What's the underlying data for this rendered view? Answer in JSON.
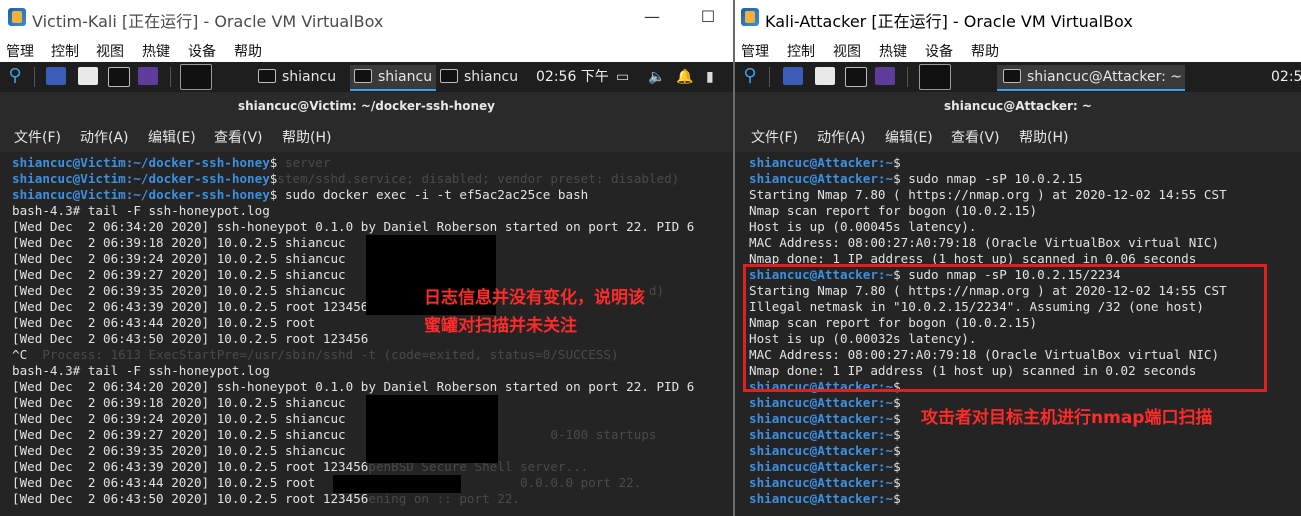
{
  "left_window": {
    "title": "Victim-Kali [正在运行] - Oracle VM VirtualBox",
    "minimize": "—",
    "restore": "☐",
    "menu": [
      "管理",
      "控制",
      "视图",
      "热键",
      "设备",
      "帮助"
    ],
    "taskbar": {
      "tasks": [
        "shiancu",
        "shiancu",
        "shiancu"
      ],
      "clock": "02:56 下午"
    },
    "terminal": {
      "title": "shiancuc@Victim: ~/docker-ssh-honey",
      "menu": [
        "文件(F)",
        "动作(A)",
        "编辑(E)",
        "查看(V)",
        "帮助(H)"
      ],
      "lines": [
        {
          "prompt_user": "shiancuc@Victim",
          "prompt_path": ":~/docker-ssh-honey",
          "prompt_char": "$",
          "text": "",
          "ghost": " server"
        },
        {
          "prompt_user": "shiancuc@Victim",
          "prompt_path": ":~/docker-ssh-honey",
          "prompt_char": "$",
          "text": "",
          "ghost": "stem/sshd.service; disabled; vendor preset: disabled)"
        },
        {
          "prompt_user": "shiancuc@Victim",
          "prompt_path": ":~/docker-ssh-honey",
          "prompt_char": "$",
          "text": " sudo docker exec -i -t ef5ac2ac25ce bash"
        },
        {
          "text": "bash-4.3# tail -F ssh-honeypot.log"
        },
        {
          "text": "[Wed Dec  2 06:34:20 2020] ssh-honeypot 0.1.0 by Daniel Roberson started on port 22. PID 6"
        },
        {
          "text": "[Wed Dec  2 06:39:18 2020] 10.0.2.5 shiancuc"
        },
        {
          "text": "[Wed Dec  2 06:39:24 2020] 10.0.2.5 shiancuc"
        },
        {
          "text": "[Wed Dec  2 06:39:27 2020] 10.0.2.5 shiancuc"
        },
        {
          "text": "[Wed Dec  2 06:39:35 2020] 10.0.2.5 shiancuc",
          "ghost": "                                        d)"
        },
        {
          "text": "[Wed Dec  2 06:43:39 2020] 10.0.2.5 root 123456"
        },
        {
          "text": "[Wed Dec  2 06:43:44 2020] 10.0.2.5 root"
        },
        {
          "text": "[Wed Dec  2 06:43:50 2020] 10.0.2.5 root 123456"
        },
        {
          "text": "^C",
          "ghost": "  Process: 1613 ExecStartPre=/usr/sbin/sshd -t (code=exited, status=0/SUCCESS)"
        },
        {
          "text": "bash-4.3# tail -F ssh-honeypot.log"
        },
        {
          "text": "[Wed Dec  2 06:34:20 2020] ssh-honeypot 0.1.0 by Daniel Roberson started on port 22. PID 6"
        },
        {
          "text": "[Wed Dec  2 06:39:18 2020] 10.0.2.5 shiancuc"
        },
        {
          "text": "[Wed Dec  2 06:39:24 2020] 10.0.2.5 shiancuc"
        },
        {
          "text": "[Wed Dec  2 06:39:27 2020] 10.0.2.5 shiancuc",
          "ghost": "                           0-100 startups"
        },
        {
          "text": "[Wed Dec  2 06:39:35 2020] 10.0.2.5 shiancuc"
        },
        {
          "text": "[Wed Dec  2 06:43:39 2020] 10.0.2.5 root 123456",
          "ghost": "penBSD Secure Shell server..."
        },
        {
          "text": "[Wed Dec  2 06:43:44 2020] 10.0.2.5 root",
          "ghost": "                           0.0.0.0 port 22."
        },
        {
          "text": "[Wed Dec  2 06:43:50 2020] 10.0.2.5 root 123456",
          "ghost": "ening on :: port 22."
        }
      ]
    },
    "annotation": "日志信息并没有变化，说明该\n蜜罐对扫描并未关注"
  },
  "right_window": {
    "title": "Kali-Attacker [正在运行] - Oracle VM VirtualBox",
    "menu": [
      "管理",
      "控制",
      "视图",
      "热键",
      "设备",
      "帮助"
    ],
    "taskbar": {
      "tasks": [
        "shiancuc@Attacker: ~"
      ],
      "clock": "02:5"
    },
    "terminal": {
      "title": "shiancuc@Attacker: ~",
      "menu": [
        "文件(F)",
        "动作(A)",
        "编辑(E)",
        "查看(V)",
        "帮助(H)"
      ],
      "lines": [
        {
          "prompt_user": "shiancuc@Attacker",
          "prompt_path": ":~",
          "prompt_char": "$",
          "text": ""
        },
        {
          "prompt_user": "shiancuc@Attacker",
          "prompt_path": ":~",
          "prompt_char": "$",
          "text": " sudo nmap -sP 10.0.2.15"
        },
        {
          "text": "Starting Nmap 7.80 ( https://nmap.org ) at 2020-12-02 14:55 CST"
        },
        {
          "text": "Nmap scan report for bogon (10.0.2.15)"
        },
        {
          "text": "Host is up (0.00045s latency)."
        },
        {
          "text": "MAC Address: 08:00:27:A0:79:18 (Oracle VirtualBox virtual NIC)"
        },
        {
          "text": "Nmap done: 1 IP address (1 host up) scanned in 0.06 seconds"
        },
        {
          "prompt_user": "shiancuc@Attacker",
          "prompt_path": ":~",
          "prompt_char": "$",
          "text": " sudo nmap -sP 10.0.2.15/2234"
        },
        {
          "text": "Starting Nmap 7.80 ( https://nmap.org ) at 2020-12-02 14:55 CST"
        },
        {
          "text": "Illegal netmask in \"10.0.2.15/2234\". Assuming /32 (one host)"
        },
        {
          "text": "Nmap scan report for bogon (10.0.2.15)"
        },
        {
          "text": "Host is up (0.00032s latency)."
        },
        {
          "text": "MAC Address: 08:00:27:A0:79:18 (Oracle VirtualBox virtual NIC)"
        },
        {
          "text": "Nmap done: 1 IP address (1 host up) scanned in 0.02 seconds"
        },
        {
          "prompt_user": "shiancuc@Attacker",
          "prompt_path": ":~",
          "prompt_char": "$",
          "text": ""
        },
        {
          "prompt_user": "shiancuc@Attacker",
          "prompt_path": ":~",
          "prompt_char": "$",
          "text": ""
        },
        {
          "prompt_user": "shiancuc@Attacker",
          "prompt_path": ":~",
          "prompt_char": "$",
          "text": ""
        },
        {
          "prompt_user": "shiancuc@Attacker",
          "prompt_path": ":~",
          "prompt_char": "$",
          "text": ""
        },
        {
          "prompt_user": "shiancuc@Attacker",
          "prompt_path": ":~",
          "prompt_char": "$",
          "text": ""
        },
        {
          "prompt_user": "shiancuc@Attacker",
          "prompt_path": ":~",
          "prompt_char": "$",
          "text": ""
        },
        {
          "prompt_user": "shiancuc@Attacker",
          "prompt_path": ":~",
          "prompt_char": "$",
          "text": ""
        },
        {
          "prompt_user": "shiancuc@Attacker",
          "prompt_path": ":~",
          "prompt_char": "$",
          "text": ""
        }
      ]
    },
    "annotation": "攻击者对目标主机进行nmap端口扫描"
  },
  "colors": {
    "prompt_blue": "#3d8fe0",
    "terminal_bg": "#242424",
    "annotation_red": "#ff2a2a",
    "highlight_box": "#e02020"
  },
  "icons": [
    "virtualbox-icon",
    "kali-dragon-icon",
    "terminal-icon",
    "folder-icon",
    "volume-icon",
    "notification-bell-icon",
    "battery-icon"
  ]
}
